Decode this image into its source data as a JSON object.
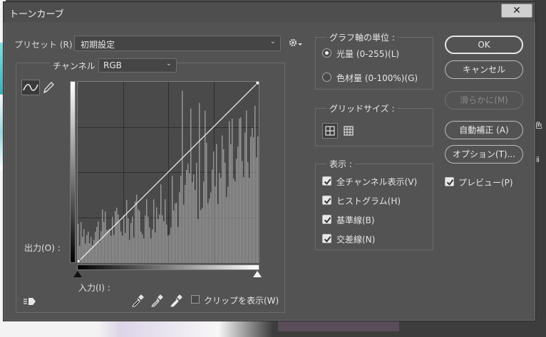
{
  "dialog": {
    "title": "トーンカーブ",
    "close_label": "✕"
  },
  "preset": {
    "label": "プリセット (R) :",
    "value": "初期設定"
  },
  "curve": {
    "channel_label": "チャンネル :",
    "channel_value": "RGB",
    "output_label": "出力(O) :",
    "input_label": "入力(I) :",
    "clip_label": "クリップを表示(W)",
    "clip_checked": false
  },
  "graph_unit": {
    "title": "グラフ軸の単位 :",
    "options": [
      {
        "label": "光量 (0-255)(L)",
        "selected": true
      },
      {
        "label": "色材量 (0-100%)(G)",
        "selected": false
      }
    ]
  },
  "grid_size": {
    "title": "グリッドサイズ :",
    "selected": "4x4"
  },
  "display": {
    "title": "表示 :",
    "options": [
      {
        "label": "全チャンネル表示(V)",
        "checked": true
      },
      {
        "label": "ヒストグラム(H)",
        "checked": true
      },
      {
        "label": "基準線(B)",
        "checked": true
      },
      {
        "label": "交差線(N)",
        "checked": true
      }
    ]
  },
  "buttons": {
    "ok": "OK",
    "cancel": "キャンセル",
    "smooth": "滑らかに(M)",
    "auto": "自動補正 (A)",
    "options": "オプション(T)..."
  },
  "preview": {
    "label": "プレビュー(P)",
    "checked": true
  },
  "background": {
    "right_panel_items": [
      "色",
      "ⅲ",
      "",
      "",
      "",
      ""
    ]
  }
}
